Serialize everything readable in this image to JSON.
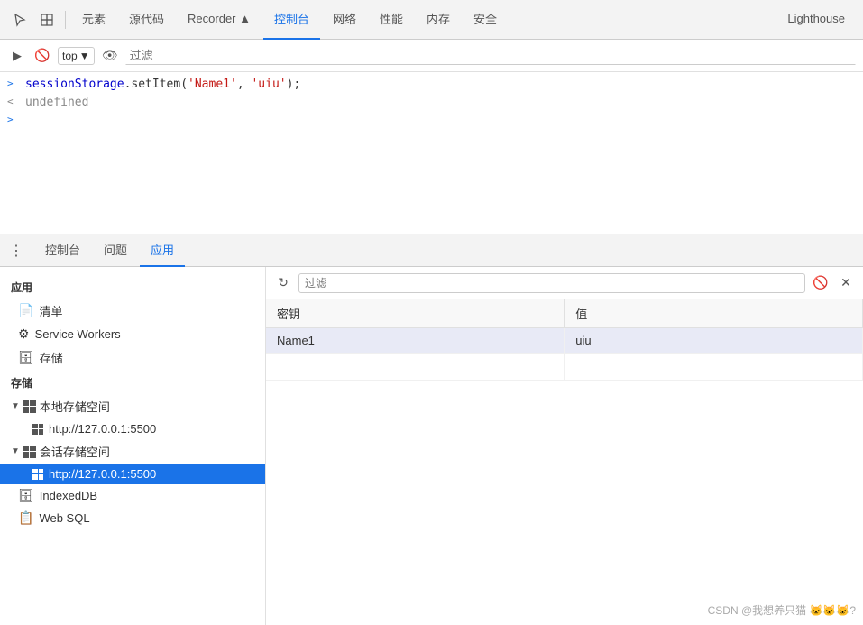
{
  "topTabs": {
    "items": [
      {
        "label": "元素",
        "active": false
      },
      {
        "label": "源代码",
        "active": false
      },
      {
        "label": "Recorder ▲",
        "active": false
      },
      {
        "label": "控制台",
        "active": true
      },
      {
        "label": "网络",
        "active": false
      },
      {
        "label": "性能",
        "active": false
      },
      {
        "label": "内存",
        "active": false
      },
      {
        "label": "安全",
        "active": false
      },
      {
        "label": "Lighthouse",
        "active": false
      }
    ]
  },
  "consoleToolbar": {
    "topLabel": "top",
    "filterPlaceholder": "过滤"
  },
  "consoleLines": [
    {
      "type": "input",
      "arrow": ">",
      "code": "sessionStorage.setItem('Name1', 'uiu');"
    },
    {
      "type": "output",
      "arrow": "<",
      "text": "undefined"
    },
    {
      "type": "prompt",
      "arrow": ">",
      "code": ""
    }
  ],
  "bottomTabs": {
    "items": [
      {
        "label": "控制台",
        "active": false
      },
      {
        "label": "问题",
        "active": false
      },
      {
        "label": "应用",
        "active": true
      }
    ]
  },
  "sidebar": {
    "sections": [
      {
        "title": "应用",
        "items": [
          {
            "icon": "📄",
            "label": "清单",
            "type": "item"
          },
          {
            "icon": "⚙",
            "label": "Service Workers",
            "type": "item"
          },
          {
            "icon": "🗄",
            "label": "存储",
            "type": "item"
          }
        ]
      },
      {
        "title": "存储",
        "items": [
          {
            "icon": "grid",
            "label": "本地存储空间",
            "type": "group",
            "expanded": true,
            "children": [
              {
                "icon": "grid",
                "label": "http://127.0.0.1:5500",
                "selected": false
              }
            ]
          },
          {
            "icon": "grid",
            "label": "会话存储空间",
            "type": "group",
            "expanded": true,
            "children": [
              {
                "icon": "grid",
                "label": "http://127.0.0.1:5500",
                "selected": true
              }
            ]
          },
          {
            "icon": "🗄",
            "label": "IndexedDB",
            "type": "item"
          },
          {
            "icon": "📋",
            "label": "Web SQL",
            "type": "item"
          }
        ]
      }
    ]
  },
  "rightPanel": {
    "filterPlaceholder": "过滤",
    "tableHeaders": [
      "密钥",
      "值"
    ],
    "tableRows": [
      {
        "key": "Name1",
        "value": "uiu"
      }
    ]
  },
  "watermark": "CSDN @我想养只猫 🐱🐱🐱?"
}
